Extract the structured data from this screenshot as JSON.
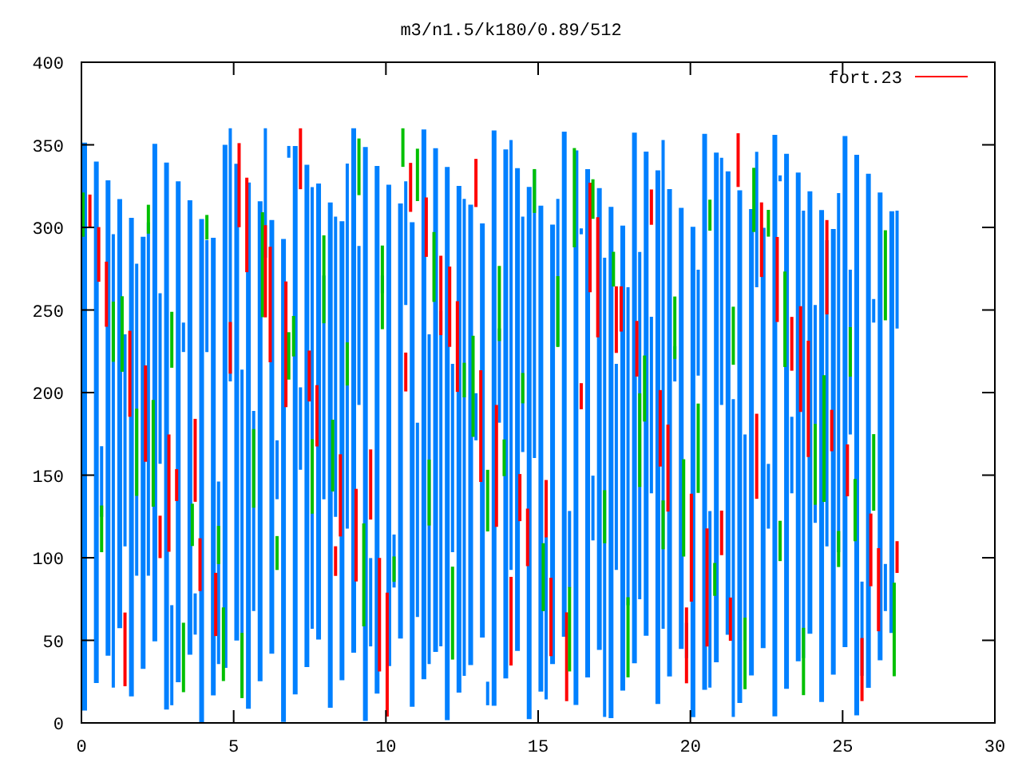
{
  "chart": {
    "title": "m3/n1.5/k180/0.89/512",
    "legend": {
      "label": "fort.23"
    },
    "yticks": [
      "400",
      "350",
      "300",
      "250",
      "200",
      "150",
      "100",
      "50",
      "0"
    ],
    "xticks": [
      "0",
      "5",
      "10",
      "15",
      "20",
      "25",
      "30"
    ]
  }
}
